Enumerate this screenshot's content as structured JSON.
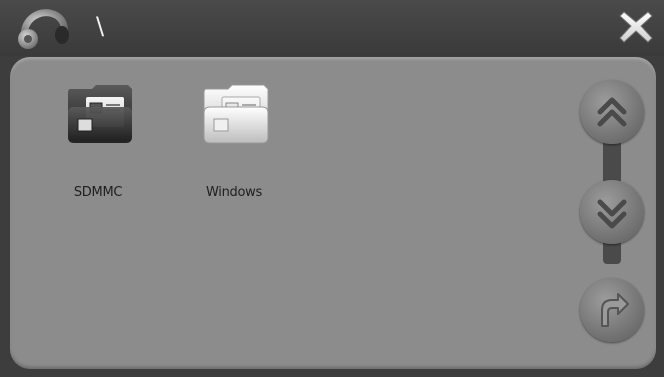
{
  "header": {
    "path": "\\"
  },
  "folders": [
    {
      "label": "SDMMC",
      "variant": "dark"
    },
    {
      "label": "Windows",
      "variant": "light"
    }
  ],
  "icons": {
    "app": "headphones-icon",
    "close": "close-icon",
    "scroll_up": "double-chevron-up-icon",
    "scroll_down": "double-chevron-down-icon",
    "back": "back-arrow-icon"
  },
  "colors": {
    "header_bg": "#3d3d3d",
    "panel_bg": "#8c8c8c",
    "label_text": "#202020",
    "path_text": "#f2f2f2"
  }
}
